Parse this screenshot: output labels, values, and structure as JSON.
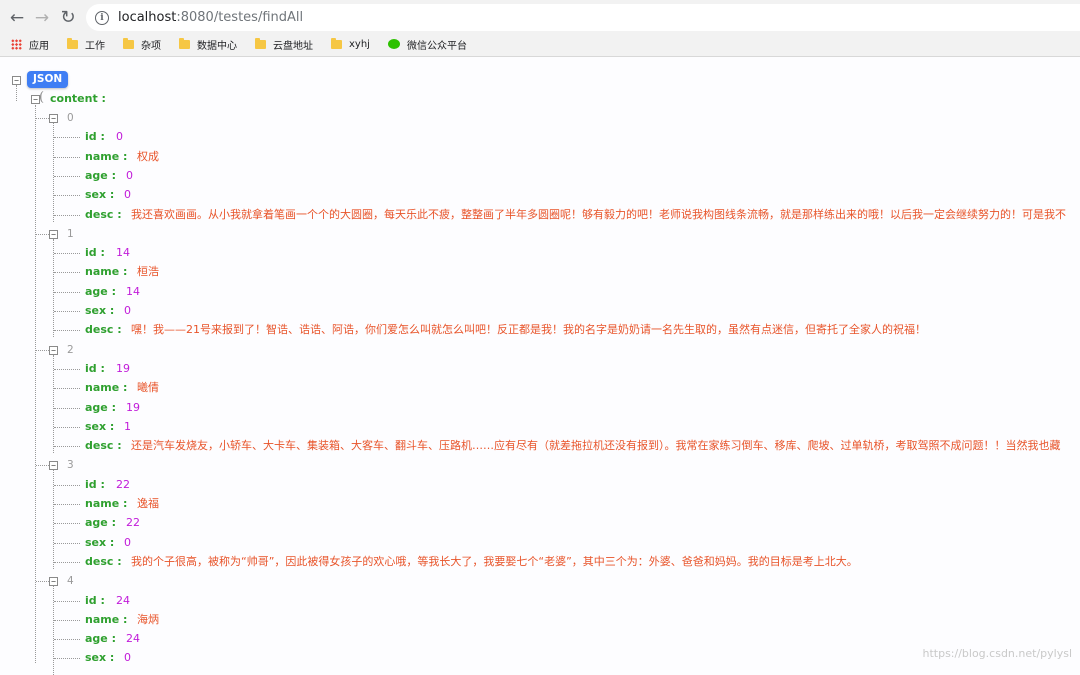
{
  "browser": {
    "url_host": "localhost",
    "url_path": ":8080/testes/findAll",
    "bookmarks": [
      "应用",
      "工作",
      "杂项",
      "数据中心",
      "云盘地址",
      "xyhj",
      "微信公众平台"
    ]
  },
  "viewer": {
    "root_label": "JSON",
    "content_key": "content :",
    "labels": {
      "id": "id :",
      "name": "name :",
      "age": "age :",
      "sex": "sex :",
      "desc": "desc :"
    },
    "items": [
      {
        "index": "0",
        "id": "0",
        "name": "权成",
        "age": "0",
        "sex": "0",
        "desc": "我还喜欢画画。从小我就拿着笔画一个个的大圆圈，每天乐此不疲，整整画了半年多圆圈呢！够有毅力的吧！老师说我构图线条流畅，就是那样练出来的哦！以后我一定会继续努力的！可是我不"
      },
      {
        "index": "1",
        "id": "14",
        "name": "桓浩",
        "age": "14",
        "sex": "0",
        "desc": "嘿！我——21号来报到了！智诰、诰诰、阿诰，你们爱怎么叫就怎么叫吧！反正都是我！我的名字是奶奶请一名先生取的，虽然有点迷信，但寄托了全家人的祝福！"
      },
      {
        "index": "2",
        "id": "19",
        "name": "曦倩",
        "age": "19",
        "sex": "1",
        "desc": "还是汽车发烧友，小轿车、大卡车、集装箱、大客车、翻斗车、压路机……应有尽有（就差拖拉机还没有报到）。我常在家练习倒车、移库、爬坡、过单轨桥，考取驾照不成问题！！当然我也藏"
      },
      {
        "index": "3",
        "id": "22",
        "name": "逸福",
        "age": "22",
        "sex": "0",
        "desc": "我的个子很高，被称为“帅哥”，因此被得女孩子的欢心哦，等我长大了，我要娶七个“老婆”，其中三个为：外婆、爸爸和妈妈。我的目标是考上北大。"
      },
      {
        "index": "4",
        "id": "24",
        "name": "海炳",
        "age": "24",
        "sex": "0",
        "desc": ""
      }
    ]
  },
  "watermark": "https://blog.csdn.net/pylysl",
  "colors": {
    "key": "#2fa02f",
    "number": "#c11bd9",
    "string": "#e8542a",
    "badge": "#3f7ef4"
  }
}
